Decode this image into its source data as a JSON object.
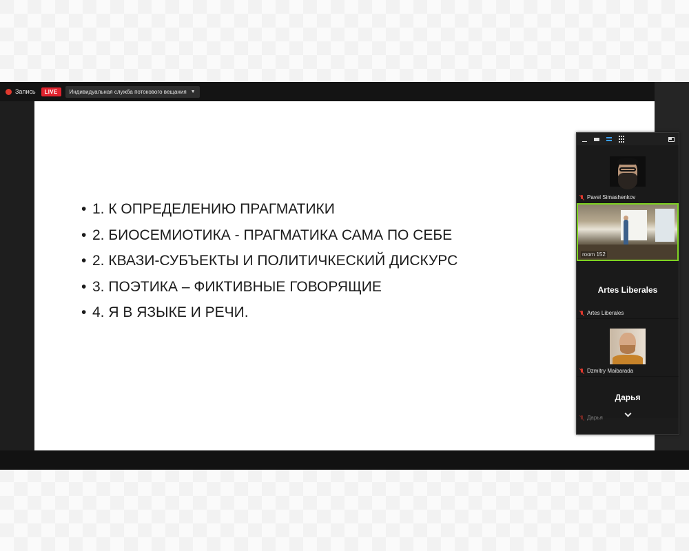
{
  "topbar": {
    "record_label": "Запись",
    "live_label": "LIVE",
    "stream_service": "Индивидуальная служба потокового вещания"
  },
  "slide": {
    "items": [
      "1.  К ОПРЕДЕЛЕНИЮ ПРАГМАТИКИ",
      "2. БИОСЕМИОТИКА  -  ПРАГМАТИКА  САМА ПО СЕБЕ",
      "2. КВАЗИ-СУБЪЕКТЫ И ПОЛИТИЧКЕСКИЙ ДИСКУРС",
      "3. ПОЭТИКА – ФИКТИВНЫЕ ГОВОРЯЩИЕ",
      "4. Я В ЯЗЫКЕ И РЕЧИ."
    ]
  },
  "gallery": {
    "participants": [
      {
        "name": "Pavel Simashenkov"
      },
      {
        "name": "room 152"
      },
      {
        "display": "Artes Liberales",
        "name": "Artes Liberales"
      },
      {
        "name": "Dzmitry Maibarada"
      },
      {
        "display": "Дарья",
        "name": "Дарья"
      }
    ]
  },
  "colors": {
    "live_badge": "#e0232e",
    "active_speaker_border": "#7ed321",
    "muted_mic": "#e0392e"
  }
}
